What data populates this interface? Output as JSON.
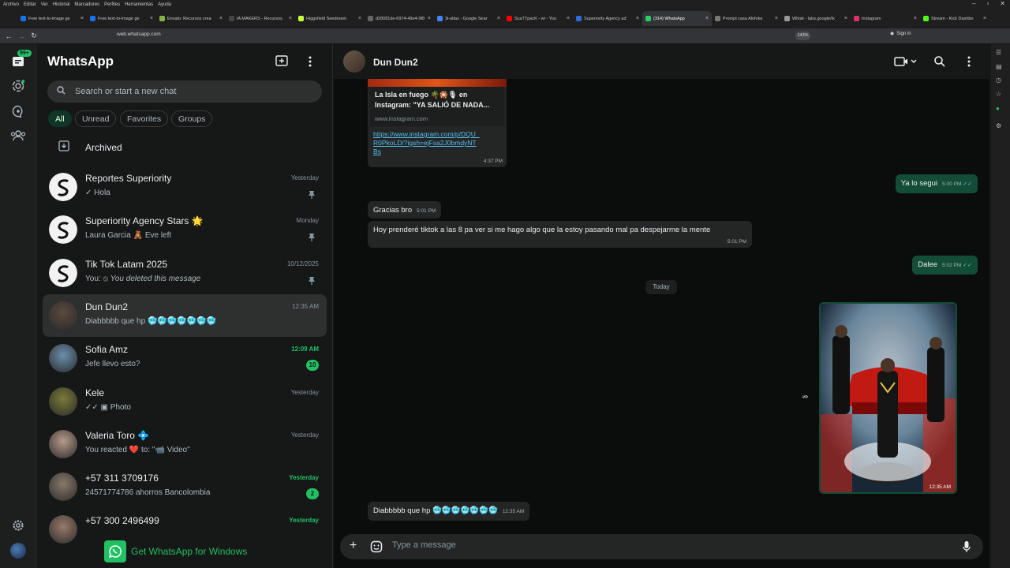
{
  "browser": {
    "menu": [
      "Archivo",
      "Editar",
      "Ver",
      "Historial",
      "Marcadores",
      "Perfiles",
      "Herramientas",
      "Ayuda"
    ],
    "tabs": [
      {
        "title": "Free text-to-image ge",
        "color": "#1a73e8"
      },
      {
        "title": "Free text-to-image ge",
        "color": "#1a73e8"
      },
      {
        "title": "Envato: Recursos crea",
        "color": "#82b541"
      },
      {
        "title": "IA MAKERS - Recursos",
        "color": "#444"
      },
      {
        "title": "Higgsfield Seedream",
        "color": "#c6ff3d"
      },
      {
        "title": "d28081de-6974-49e4-9f8",
        "color": "#666"
      },
      {
        "title": "3i-atlas - Google Sear",
        "color": "#4285f4"
      },
      {
        "title": "ScaTTpacK - wi - You",
        "color": "#ff0000"
      },
      {
        "title": "Superiority Agency ad",
        "color": "#2d6cdf"
      },
      {
        "title": "(314) WhatsApp",
        "color": "#25d366"
      },
      {
        "title": "Prompt casa Alofoke",
        "color": "#777"
      },
      {
        "title": "Whisk - labs.google/fx",
        "color": "#999"
      },
      {
        "title": "Instagram",
        "color": "#e1306c"
      },
      {
        "title": "Stream - Kick Dashbo",
        "color": "#53fc18"
      }
    ],
    "active_tab_index": 9,
    "url": "web.whatsapp.com",
    "zoom": "143%",
    "signin": "Sign in"
  },
  "rail": {
    "chats_badge": "99+"
  },
  "sidebar": {
    "title": "WhatsApp",
    "search_placeholder": "Search or start a new chat",
    "filters": [
      "All",
      "Unread",
      "Favorites",
      "Groups"
    ],
    "archived_label": "Archived",
    "get_app_label": "Get WhatsApp for Windows"
  },
  "chats": [
    {
      "name": "Reportes Superiority",
      "preview": "Hola",
      "time": "Yesterday",
      "pinned": true,
      "ticks": "single",
      "avatar": "logo"
    },
    {
      "name": "Superiority Agency Stars 🌟",
      "preview": "Laura Garcia 🧸 Eve left",
      "time": "Monday",
      "pinned": true,
      "avatar": "logo"
    },
    {
      "name": "Tik Tok Latam 2025",
      "preview_prefix": "You:",
      "preview": "You deleted this message",
      "time": "10/12/2025",
      "pinned": true,
      "deleted": true,
      "avatar": "logo"
    },
    {
      "name": "Dun Dun2",
      "preview": "Diabbbbb que hp 🥶🥶🥶🥶🥶🥶🥶",
      "time": "12:35 AM",
      "selected": true,
      "avatar": "#5a4a3e"
    },
    {
      "name": "Sofia Amz",
      "preview": "Jefe llevo esto?",
      "time": "12:09 AM",
      "time_green": true,
      "unread": "10",
      "avatar": "#6b8fae"
    },
    {
      "name": "Kele",
      "preview": "Photo",
      "time": "Yesterday",
      "ticks": "double",
      "photo": true,
      "avatar": "#7a7a3a"
    },
    {
      "name": "Valeria Toro 💠",
      "preview": "You reacted ❤️ to: \"📹 Video\"",
      "time": "Yesterday",
      "avatar": "#b89a8a"
    },
    {
      "name": "+57 311 3709176",
      "preview": "24571774786 ahorros Bancolombia",
      "time": "Yesterday",
      "time_green": true,
      "unread": "2",
      "avatar": "#8a7a6a"
    },
    {
      "name": "+57 300 2496499",
      "preview": "",
      "time": "Yesterday",
      "time_green": true,
      "avatar": "#9a7a6a"
    }
  ],
  "conversation": {
    "contact": "Dun Dun2",
    "link_preview": {
      "title": "La Isla en fuego 🌴🎇🎙 en Instagram: \"YA SALIÓ DE NADA...",
      "domain": "www.instagram.com",
      "url": "https://www.instagram.com/p/DQU_R0PkoLD/?igsh=ejFsa2J0bmdyNTBs",
      "time": "4:37 PM"
    },
    "messages": [
      {
        "dir": "out",
        "text": "Ya lo segui",
        "time": "5:00 PM"
      },
      {
        "dir": "in",
        "text": "Gracias bro",
        "time": "5:01 PM"
      },
      {
        "dir": "in",
        "text": "Hoy prenderé tiktok a las 8 pa ver si me hago algo que la estoy pasando mal pa despejarme la mente",
        "time": "5:01 PM"
      },
      {
        "dir": "out",
        "text": "Dalee",
        "time": "5:02 PM"
      },
      {
        "dir": "out",
        "image": true,
        "time": "12:35 AM"
      },
      {
        "dir": "in",
        "text": "Diabbbbb que hp 🥶🥶🥶🥶🥶🥶🥶",
        "time": "12:35 AM"
      }
    ],
    "day_separator": "Today",
    "composer_placeholder": "Type a message"
  }
}
